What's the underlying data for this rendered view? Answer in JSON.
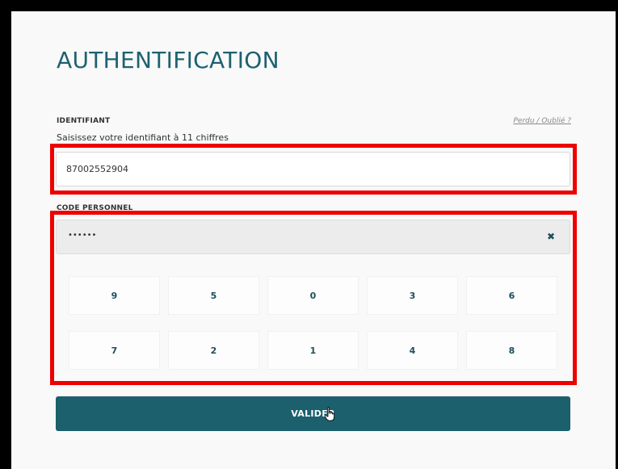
{
  "page": {
    "title": "AUTHENTIFICATION"
  },
  "identifier": {
    "label": "IDENTIFIANT",
    "lost_link": "Perdu / Oublié ?",
    "hint": "Saisissez votre identifiant à 11 chiffres",
    "value": "87002552904"
  },
  "personal_code": {
    "label": "CODE PERSONNEL",
    "masked_value": "••••••",
    "clear_icon": "close-icon",
    "keys_row1": [
      "9",
      "5",
      "0",
      "3",
      "6"
    ],
    "keys_row2": [
      "7",
      "2",
      "1",
      "4",
      "8"
    ]
  },
  "actions": {
    "validate_label": "VALIDER"
  },
  "colors": {
    "accent": "#1c5f6d",
    "highlight": "#ee0000",
    "title": "#1d6170"
  }
}
